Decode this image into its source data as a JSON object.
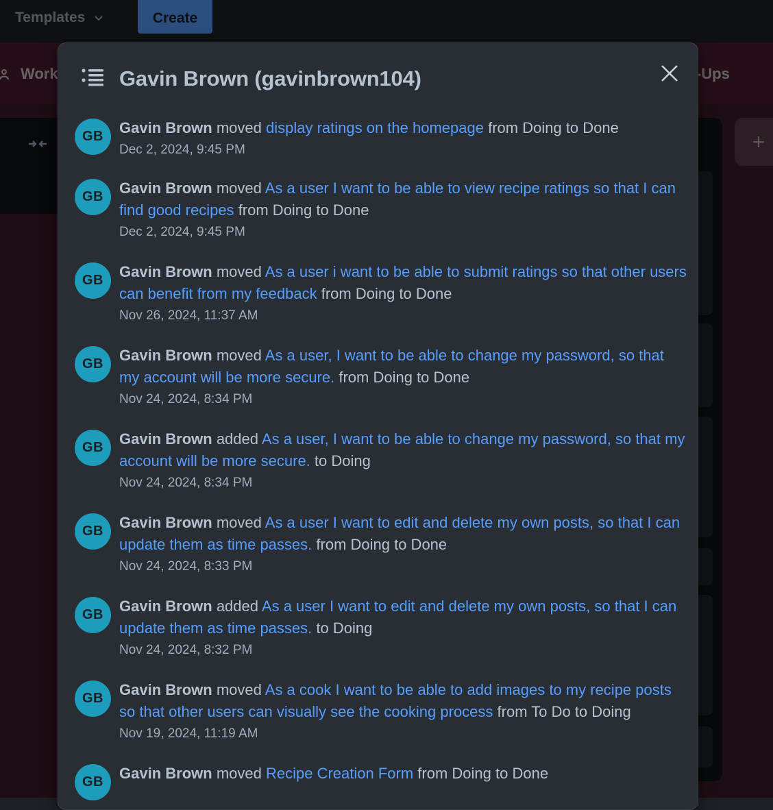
{
  "topbar": {
    "templates_label": "Templates",
    "create_label": "Create"
  },
  "board": {
    "workspace_label": "Work",
    "right_label": "-Ups",
    "add_list_symbol": "+"
  },
  "modal": {
    "title": "Gavin Brown (gavinbrown104)",
    "entries": [
      {
        "initials": "GB",
        "user": "Gavin Brown",
        "action": "moved",
        "card": "display ratings on the homepage",
        "rest": "from Doing to Done",
        "date": "Dec 2, 2024, 9:45 PM"
      },
      {
        "initials": "GB",
        "user": "Gavin Brown",
        "action": "moved",
        "card": "As a user I want to be able to view recipe ratings so that I can find good recipes",
        "rest": "from Doing to Done",
        "date": "Dec 2, 2024, 9:45 PM"
      },
      {
        "initials": "GB",
        "user": "Gavin Brown",
        "action": "moved",
        "card": "As a user i want to be able to submit ratings so that other users can benefit from my feedback",
        "rest": "from Doing to Done",
        "date": "Nov 26, 2024, 11:37 AM"
      },
      {
        "initials": "GB",
        "user": "Gavin Brown",
        "action": "moved",
        "card": "As a user, I want to be able to change my password, so that my account will be more secure.",
        "rest": "from Doing to Done",
        "date": "Nov 24, 2024, 8:34 PM"
      },
      {
        "initials": "GB",
        "user": "Gavin Brown",
        "action": "added",
        "card": "As a user, I want to be able to change my password, so that my account will be more secure.",
        "rest": "to Doing",
        "date": "Nov 24, 2024, 8:34 PM"
      },
      {
        "initials": "GB",
        "user": "Gavin Brown",
        "action": "moved",
        "card": "As a user I want to edit and delete my own posts, so that I can update them as time passes.",
        "rest": "from Doing to Done",
        "date": "Nov 24, 2024, 8:33 PM"
      },
      {
        "initials": "GB",
        "user": "Gavin Brown",
        "action": "added",
        "card": "As a user I want to edit and delete my own posts, so that I can update them as time passes.",
        "rest": "to Doing",
        "date": "Nov 24, 2024, 8:32 PM"
      },
      {
        "initials": "GB",
        "user": "Gavin Brown",
        "action": "moved",
        "card": "As a cook I want to be able to add images to my recipe posts so that other users can visually see the cooking process",
        "rest": "from To Do to Doing",
        "date": "Nov 19, 2024, 11:19 AM"
      },
      {
        "initials": "GB",
        "user": "Gavin Brown",
        "action": "moved",
        "card": "Recipe Creation Form",
        "rest": "from Doing to Done",
        "date": ""
      }
    ]
  }
}
